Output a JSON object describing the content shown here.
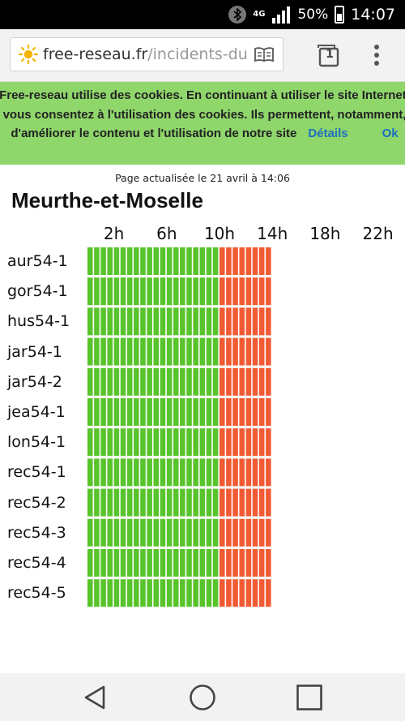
{
  "status_bar": {
    "network": "4G",
    "battery": "50%",
    "time": "14:07"
  },
  "browser": {
    "url_domain": "free-reseau.fr",
    "url_path": "/incidents-du",
    "tab_count": "1"
  },
  "cookie_banner": {
    "text": "Free-reseau utilise des cookies. En continuant à utiliser le site Internet, vous consentez à l'utilisation des cookies. Ils permettent, notamment, d'améliorer le contenu et l'utilisation de notre site",
    "details_label": "Détails",
    "ok_label": "Ok"
  },
  "page": {
    "updated": "Page actualisée le 21 avril à 14:06",
    "department": "Meurthe-et-Moselle"
  },
  "chart_data": {
    "type": "heatmap",
    "title": "Meurthe-et-Moselle",
    "x_tick_labels": [
      "2h",
      "6h",
      "10h",
      "14h",
      "18h",
      "22h"
    ],
    "rows": [
      "aur54-1",
      "gor54-1",
      "hus54-1",
      "jar54-1",
      "jar54-2",
      "jea54-1",
      "lon54-1",
      "rec54-1",
      "rec54-2",
      "rec54-3",
      "rec54-4",
      "rec54-5"
    ],
    "slot_minutes": 30,
    "slots_per_row": 48,
    "filled_slots": 28,
    "status_by_slot": "slots 1-20 (0h-10h) ok, slots 21-28 (10h-14h) incident, remaining slots not yet recorded",
    "colors": {
      "ok": "#58c42c",
      "incident": "#f15a33"
    }
  }
}
